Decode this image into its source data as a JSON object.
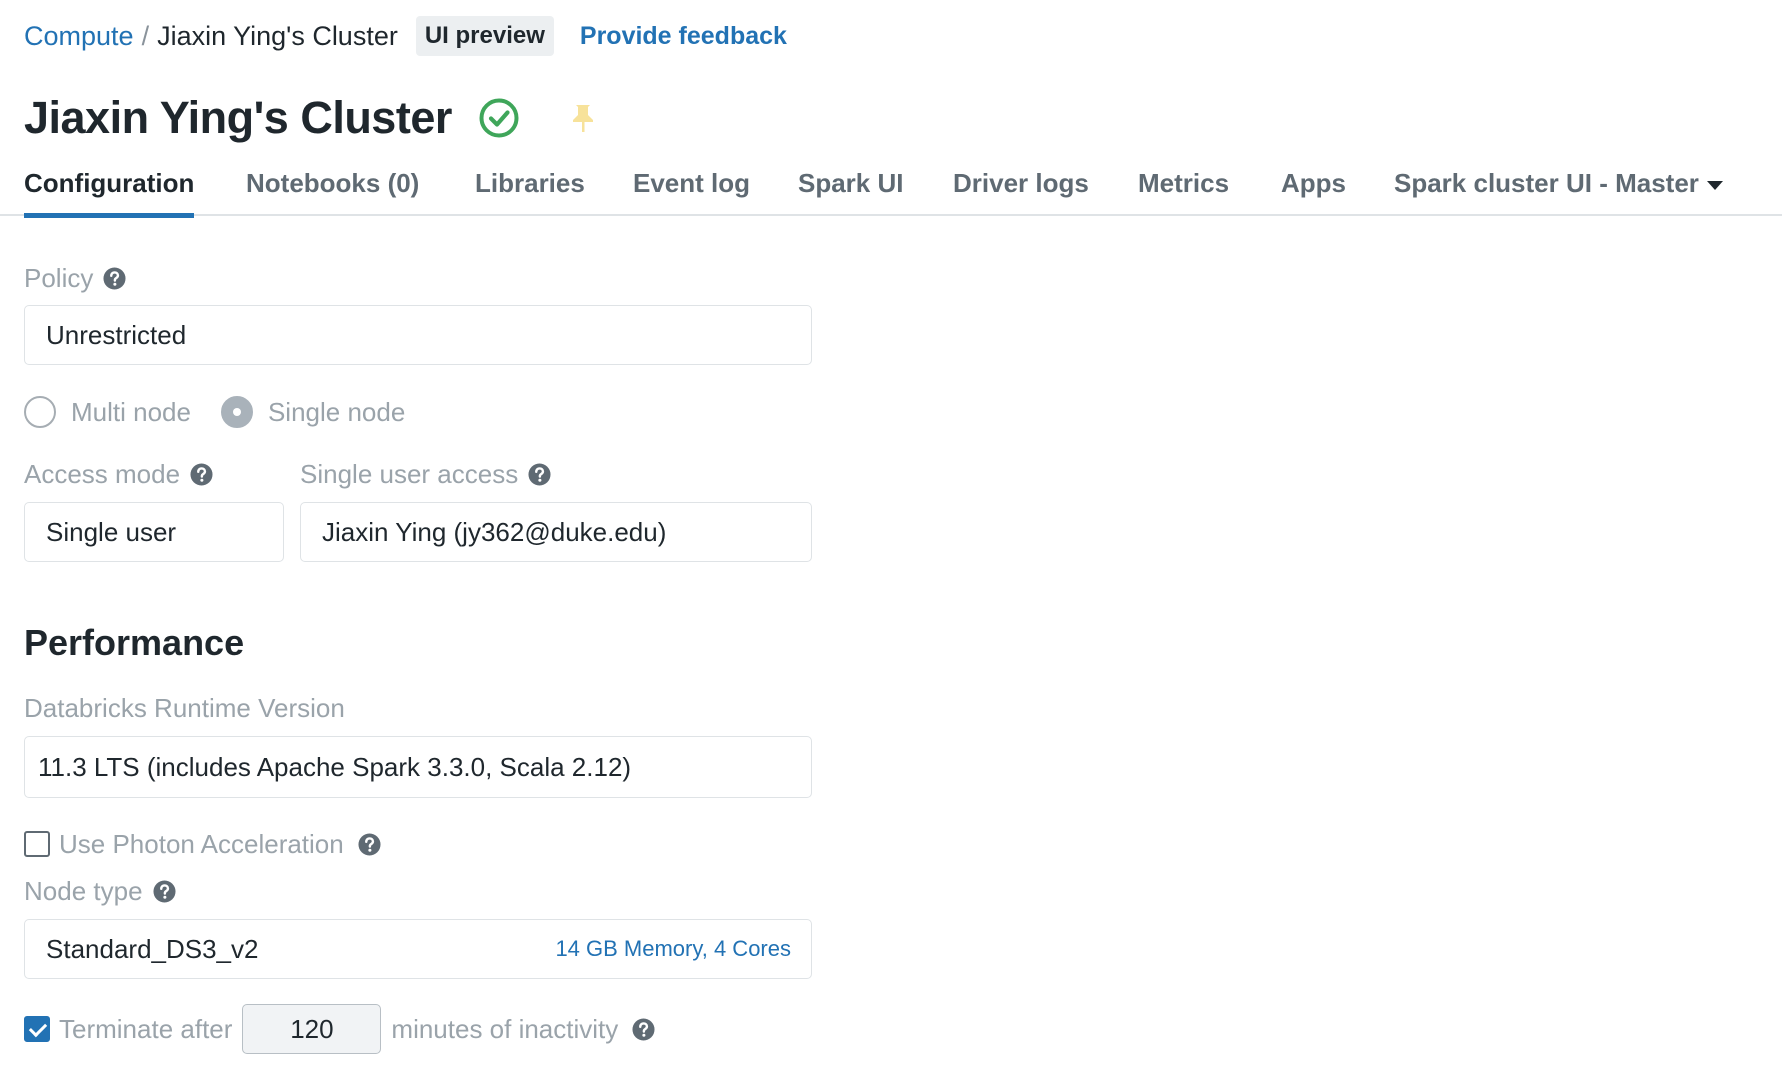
{
  "breadcrumb": {
    "root": "Compute",
    "separator": "/",
    "current": "Jiaxin Ying's Cluster",
    "preview_badge": "UI preview",
    "feedback_link": "Provide feedback"
  },
  "header": {
    "title": "Jiaxin Ying's Cluster",
    "status_icon": "check-circle-icon",
    "status_color": "#3fa65a",
    "pin_icon": "pin-icon",
    "pin_color": "#f7e29a"
  },
  "tabs": [
    {
      "label": "Configuration",
      "active": true
    },
    {
      "label": "Notebooks (0)"
    },
    {
      "label": "Libraries"
    },
    {
      "label": "Event log"
    },
    {
      "label": "Spark UI"
    },
    {
      "label": "Driver logs"
    },
    {
      "label": "Metrics"
    },
    {
      "label": "Apps"
    },
    {
      "label": "Spark cluster UI - Master"
    }
  ],
  "form": {
    "policy_label": "Policy",
    "policy_value": "Unrestricted",
    "node_modes": [
      {
        "label": "Multi node",
        "selected": false
      },
      {
        "label": "Single node",
        "selected": true
      }
    ],
    "access_mode_label": "Access mode",
    "access_mode_value": "Single user",
    "single_user_access_label": "Single user access",
    "single_user_access_value": "Jiaxin Ying (jy362@duke.edu)"
  },
  "performance": {
    "section_title": "Performance",
    "runtime_label": "Databricks Runtime Version",
    "runtime_value": "11.3 LTS (includes Apache Spark 3.3.0, Scala 2.12)",
    "photon_label": "Use Photon Acceleration",
    "photon_checked": false,
    "node_type_label": "Node type",
    "node_type_value": "Standard_DS3_v2",
    "node_type_spec": "14 GB Memory, 4 Cores",
    "terminate_label": "Terminate after",
    "terminate_checked": true,
    "terminate_minutes": "120",
    "terminate_suffix": "minutes of inactivity"
  },
  "colors": {
    "accent": "#2272b4",
    "muted_label": "#9aa3aa",
    "text": "#1f272d"
  }
}
